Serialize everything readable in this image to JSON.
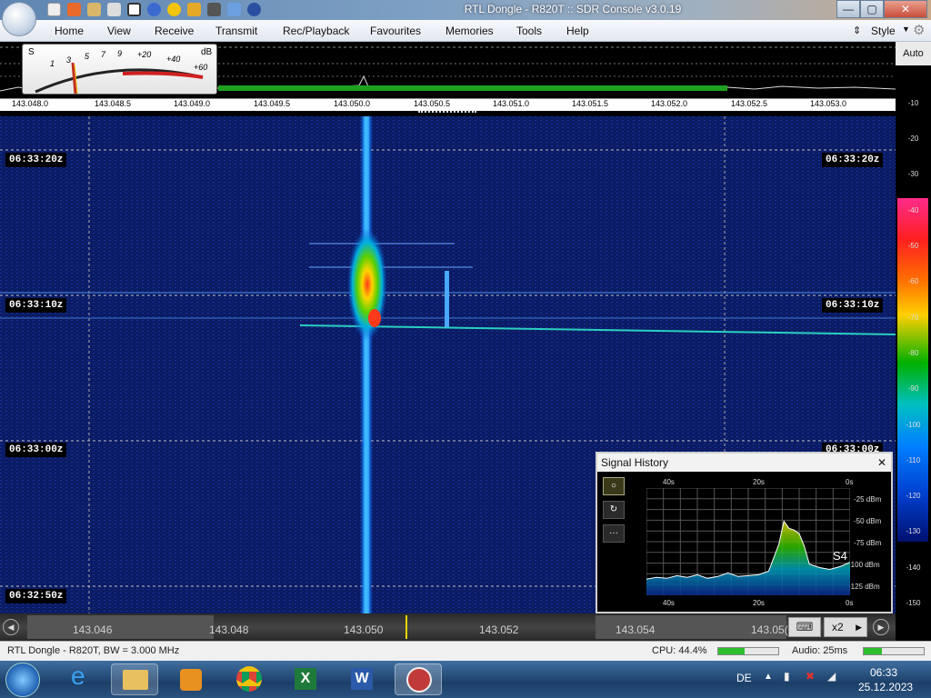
{
  "window": {
    "title": "RTL Dongle - R820T :: SDR Console v3.0.19",
    "minimize": "—",
    "maximize": "▢",
    "close": "✕"
  },
  "menu": {
    "items": [
      "Home",
      "View",
      "Receive",
      "Transmit",
      "Rec/Playback",
      "Favourites",
      "Memories",
      "Tools",
      "Help"
    ],
    "style_label": "Style"
  },
  "smeter": {
    "s_label": "S",
    "db_label": "dB",
    "ticks": [
      "1",
      "3",
      "5",
      "7",
      "9",
      "+20",
      "+40",
      "+60"
    ]
  },
  "spectrum": {
    "freq_ticks": [
      "143.048.0",
      "143.048.5",
      "143.049.0",
      "143.049.5",
      "143.050.0",
      "143.050.5",
      "143.051.0",
      "143.051.5",
      "143.052.0",
      "143.052.5",
      "143.053.0"
    ]
  },
  "scale": {
    "auto_label": "Auto",
    "db_labels": [
      "-10",
      "-20",
      "-30",
      "-40",
      "-50",
      "-60",
      "-70",
      "-80",
      "-90",
      "-100",
      "-110",
      "-120",
      "-130",
      "-140",
      "-150"
    ]
  },
  "waterfall": {
    "time_labels": [
      "06:33:20z",
      "06:33:10z",
      "06:33:00z",
      "06:32:50z"
    ],
    "signal_freq_mhz": 143.05,
    "colors": {
      "background": "#0a1b62",
      "signal": "#0a7ff7",
      "hot": "#ffd400",
      "peak": "#ff2b1a"
    }
  },
  "signal_history": {
    "title": "Signal History",
    "close": "✕",
    "buttons": [
      "○",
      "↻",
      "···"
    ],
    "x_labels": [
      "40s",
      "20s",
      "0s"
    ],
    "y_labels": [
      "-25 dBm",
      "-50 dBm",
      "-75 dBm",
      "-100 dBm",
      "-125 dBm"
    ],
    "s_reading": "S4",
    "chart_data": {
      "type": "area",
      "x": [
        40,
        38,
        36,
        34,
        32,
        30,
        28,
        26,
        24,
        22,
        20,
        18,
        16,
        14,
        13,
        12,
        11,
        10,
        9,
        8,
        6,
        4,
        2,
        0
      ],
      "values": [
        -117,
        -115,
        -116,
        -113,
        -115,
        -112,
        -116,
        -114,
        -110,
        -114,
        -113,
        -112,
        -108,
        -78,
        -52,
        -60,
        -62,
        -66,
        -80,
        -100,
        -104,
        -106,
        -103,
        -98
      ],
      "ylim": [
        -135,
        -15
      ],
      "xlim": [
        40,
        0
      ],
      "grid": true
    }
  },
  "bottom": {
    "freqs": [
      "143.046",
      "143.048",
      "143.050",
      "143.052",
      "143.054",
      "143.05("
    ],
    "zoom_label": "x2"
  },
  "status": {
    "device": "RTL Dongle - R820T, BW = 3.000 MHz",
    "cpu": "CPU: 44.4%",
    "audio": "Audio: 25ms",
    "cpu_level": 0.444,
    "audio_level": 0.3
  },
  "taskbar": {
    "lang": "DE",
    "time": "06:33",
    "date": "25.12.2023"
  }
}
